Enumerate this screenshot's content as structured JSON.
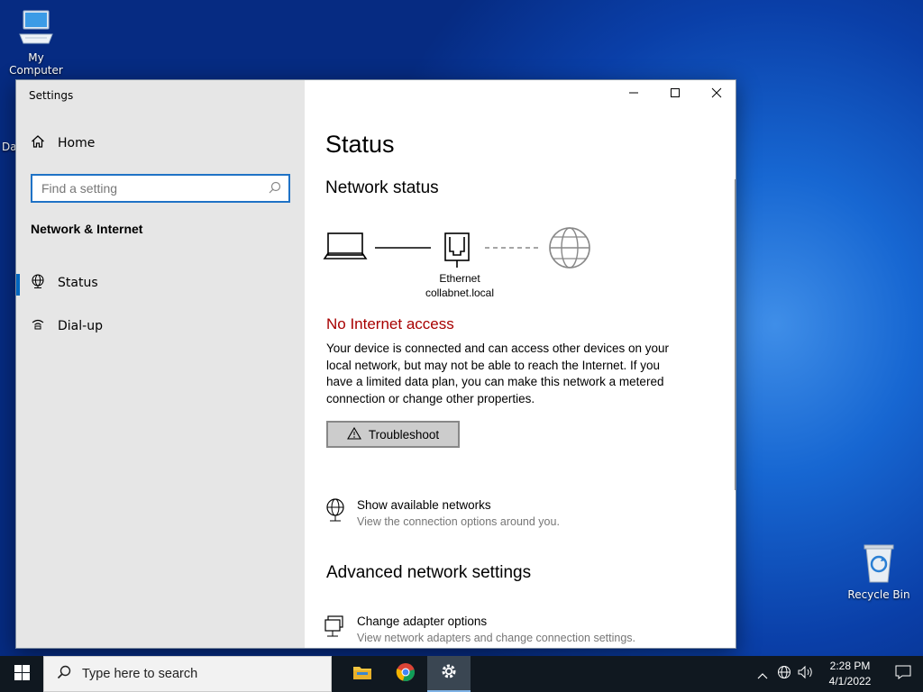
{
  "desktop": {
    "my_computer_label": "My Computer",
    "recycle_bin_label": "Recycle Bin",
    "left_sliver_text": "Da"
  },
  "window": {
    "title": "Settings",
    "sidebar": {
      "home_label": "Home",
      "search_placeholder": "Find a setting",
      "section_title": "Network & Internet",
      "items": [
        {
          "label": "Status",
          "icon": "globe-icon",
          "active": true
        },
        {
          "label": "Dial-up",
          "icon": "dialup-icon",
          "active": false
        }
      ]
    },
    "content": {
      "page_title": "Status",
      "network_status_heading": "Network status",
      "adapter_name": "Ethernet",
      "network_name": "collabnet.local",
      "alert_text": "No Internet access",
      "description": "Your device is connected and can access other devices on your local network, but may not be able to reach the Internet. If you have a limited data plan, you can make this network a metered connection or change other properties.",
      "troubleshoot_label": "Troubleshoot",
      "show_networks_title": "Show available networks",
      "show_networks_sub": "View the connection options around you.",
      "advanced_heading": "Advanced network settings",
      "adapter_options_title": "Change adapter options",
      "adapter_options_sub": "View network adapters and change connection settings."
    }
  },
  "taskbar": {
    "search_placeholder": "Type here to search",
    "apps": [
      "file-explorer-icon",
      "chrome-icon",
      "settings-icon"
    ],
    "clock_time": "2:28 PM",
    "clock_date": "4/1/2022"
  }
}
